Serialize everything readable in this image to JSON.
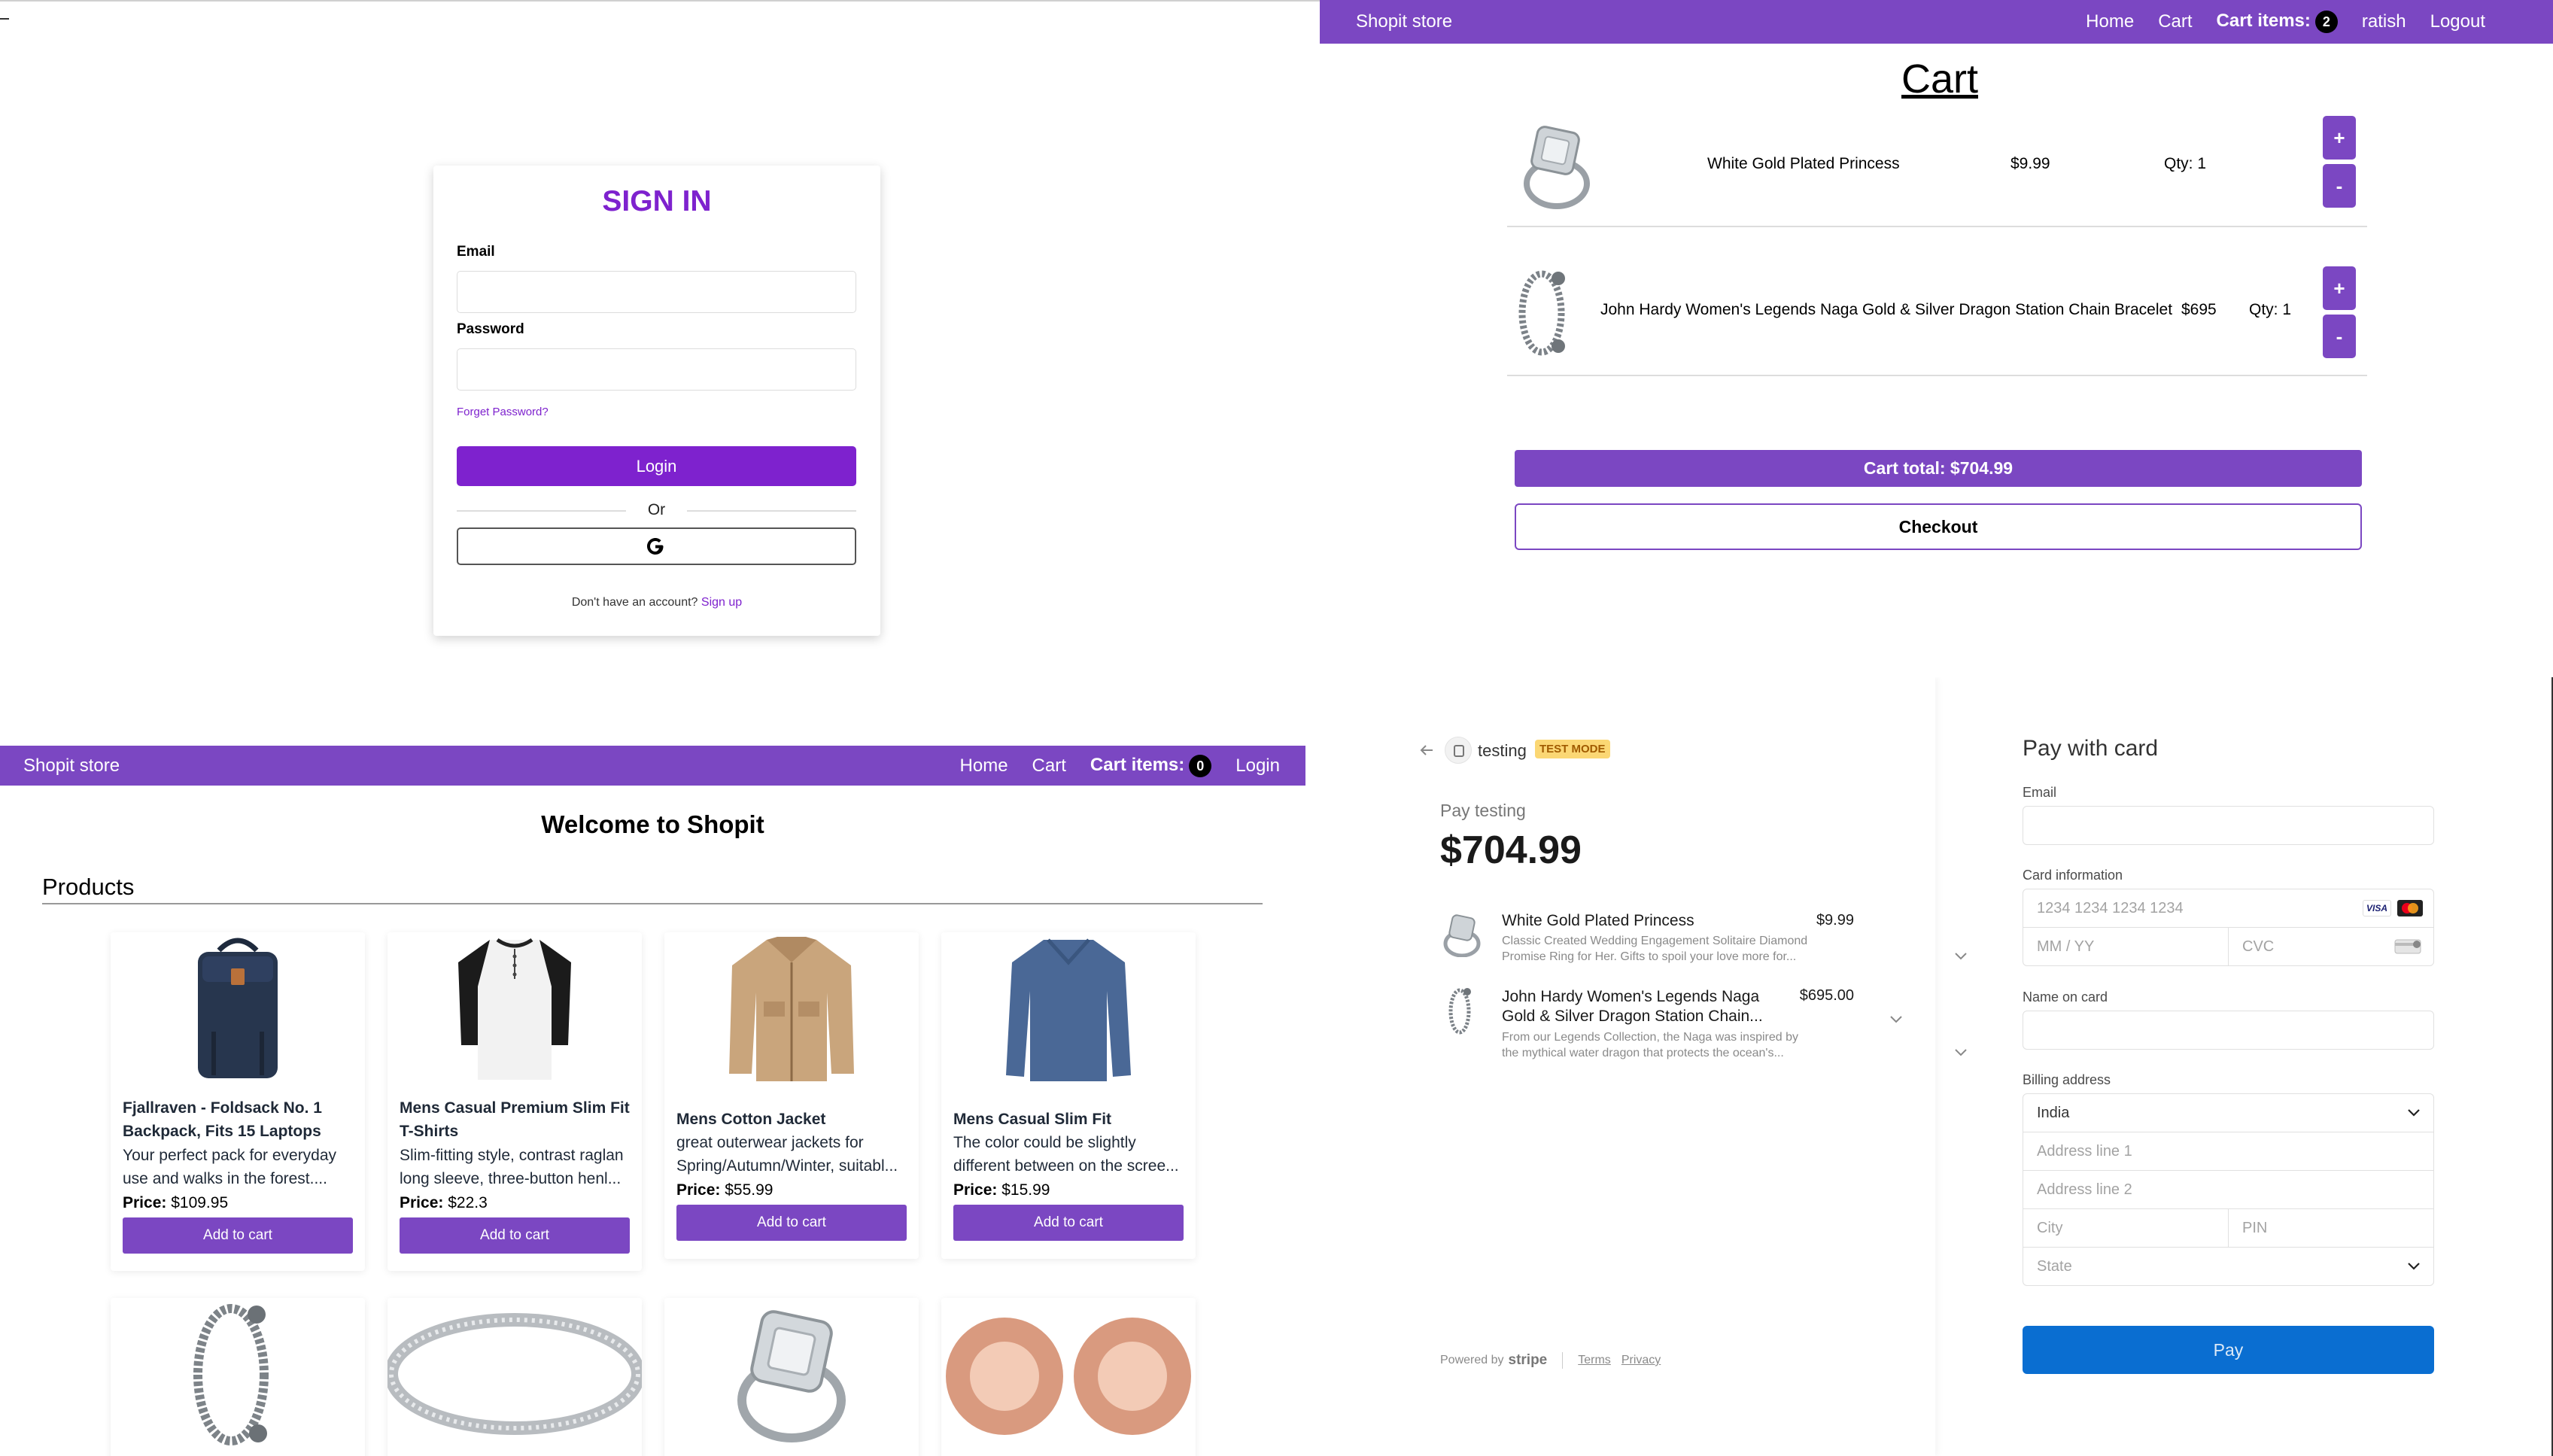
{
  "signin": {
    "title": "SIGN IN",
    "email_label": "Email",
    "email_value": "",
    "password_label": "Password",
    "password_value": "",
    "forgot_link": "Forget Password?",
    "login_button": "Login",
    "or_text": "Or",
    "no_account_text": "Don't have an account?",
    "signup_link": "Sign up"
  },
  "cart_nav": {
    "brand": "Shopit store",
    "home": "Home",
    "cart": "Cart",
    "cart_items_label": "Cart items:",
    "cart_items_count": "2",
    "user": "ratish",
    "logout": "Logout"
  },
  "cart": {
    "heading": "Cart",
    "items": [
      {
        "name": "White Gold Plated Princess",
        "price": "$9.99",
        "qty": "Qty: 1",
        "plus": "+",
        "minus": "-"
      },
      {
        "name": "John Hardy Women's Legends Naga Gold & Silver Dragon Station Chain Bracelet",
        "price": "$695",
        "qty": "Qty: 1",
        "plus": "+",
        "minus": "-"
      }
    ],
    "total": "Cart total: $704.99",
    "checkout": "Checkout"
  },
  "home_nav": {
    "brand": "Shopit store",
    "home": "Home",
    "cart": "Cart",
    "cart_items_label": "Cart items:",
    "cart_items_count": "0",
    "login": "Login"
  },
  "home": {
    "welcome": "Welcome to Shopit",
    "products_heading": "Products",
    "products": [
      {
        "title": "Fjallraven - Foldsack No. 1 Backpack, Fits 15 Laptops",
        "desc": "Your perfect pack for everyday use and walks in the forest....",
        "price_label": "Price:",
        "price": "$109.95",
        "button": "Add to cart",
        "image": "backpack"
      },
      {
        "title": "Mens Casual Premium Slim Fit T-Shirts",
        "desc": "Slim-fitting style, contrast raglan long sleeve, three-button henl...",
        "price_label": "Price:",
        "price": "$22.3",
        "button": "Add to cart",
        "image": "tshirt"
      },
      {
        "title": "Mens Cotton Jacket",
        "desc": "great outerwear jackets for Spring/Autumn/Winter, suitabl...",
        "price_label": "Price:",
        "price": "$55.99",
        "button": "Add to cart",
        "image": "jacket"
      },
      {
        "title": "Mens Casual Slim Fit",
        "desc": "The color could be slightly different between on the scree...",
        "price_label": "Price:",
        "price": "$15.99",
        "button": "Add to cart",
        "image": "longsleeve"
      }
    ],
    "row2_images": [
      "bracelet",
      "silver-ring",
      "princess-ring",
      "rose-gold-tunnels"
    ]
  },
  "stripe": {
    "merchant": "testing",
    "test_mode_badge": "TEST MODE",
    "pay_label": "Pay testing",
    "amount": "$704.99",
    "line_items": [
      {
        "name": "White Gold Plated Princess",
        "price": "$9.99",
        "desc_line1": "Classic Created Wedding Engagement Solitaire Diamond",
        "desc_line2": "Promise Ring for Her. Gifts to spoil your love more for..."
      },
      {
        "name_line1": "John Hardy Women's Legends Naga",
        "name_line2": "Gold & Silver Dragon Station Chain...",
        "price": "$695.00",
        "desc_line1": "From our Legends Collection, the Naga was inspired by",
        "desc_line2": "the mythical water dragon that protects the ocean's..."
      }
    ],
    "powered_by": "Powered by",
    "stripe_word": "stripe",
    "terms": "Terms",
    "privacy": "Privacy",
    "form_title": "Pay with card",
    "email_label": "Email",
    "card_label": "Card information",
    "card_number_placeholder": "1234 1234 1234 1234",
    "expiry_placeholder": "MM / YY",
    "cvc_placeholder": "CVC",
    "name_label": "Name on card",
    "billing_label": "Billing address",
    "country": "India",
    "address1_placeholder": "Address line 1",
    "address2_placeholder": "Address line 2",
    "city_placeholder": "City",
    "pin_placeholder": "PIN",
    "state_placeholder": "State",
    "visa": "VISA",
    "pay_button": "Pay"
  },
  "colors": {
    "nav_purple": "#7b47c2",
    "signin_purple": "#7e22ce",
    "stripe_blue": "#0a6ed1",
    "test_badge": "#fbd774"
  }
}
